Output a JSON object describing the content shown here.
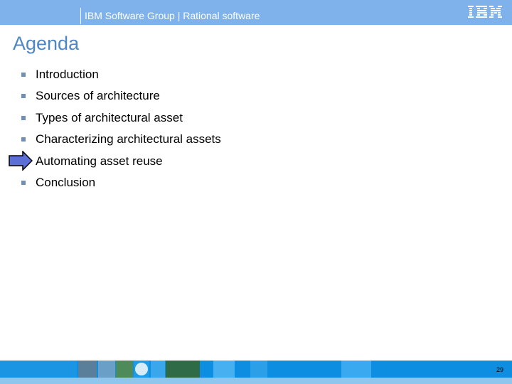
{
  "header": {
    "title": "IBM Software Group | Rational software",
    "logo_text": "IBM",
    "background": "#7fb2ea"
  },
  "page_title": "Agenda",
  "agenda_items": [
    "Introduction",
    "Sources of architecture",
    "Types of architectural asset",
    "Characterizing architectural assets",
    "Automating asset reuse",
    "Conclusion"
  ],
  "current_item_marker": "arrow-right-icon",
  "footer": {
    "page_number": "29",
    "background": "#0e8ee0"
  },
  "colors": {
    "accent_title": "#4f86c6",
    "arrow_fill": "#5b6fd6"
  }
}
